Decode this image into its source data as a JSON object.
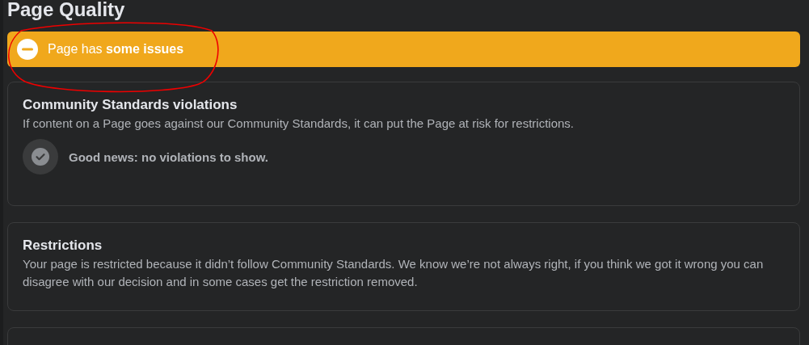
{
  "title": "Page Quality",
  "status": {
    "text": "Page has **some issues**",
    "kind": "warning"
  },
  "sections": [
    {
      "heading": "Community Standards violations",
      "description": "If content on a Page goes against our Community Standards, it can put the Page at risk for restrictions.",
      "note": "Good news: no violations to show."
    },
    {
      "heading": "Restrictions",
      "description": "Your page is restricted because it didn’t follow Community Standards. We know we’re not always right, if you think we got it wrong you can disagree with our decision and in some cases get the restriction removed."
    }
  ]
}
